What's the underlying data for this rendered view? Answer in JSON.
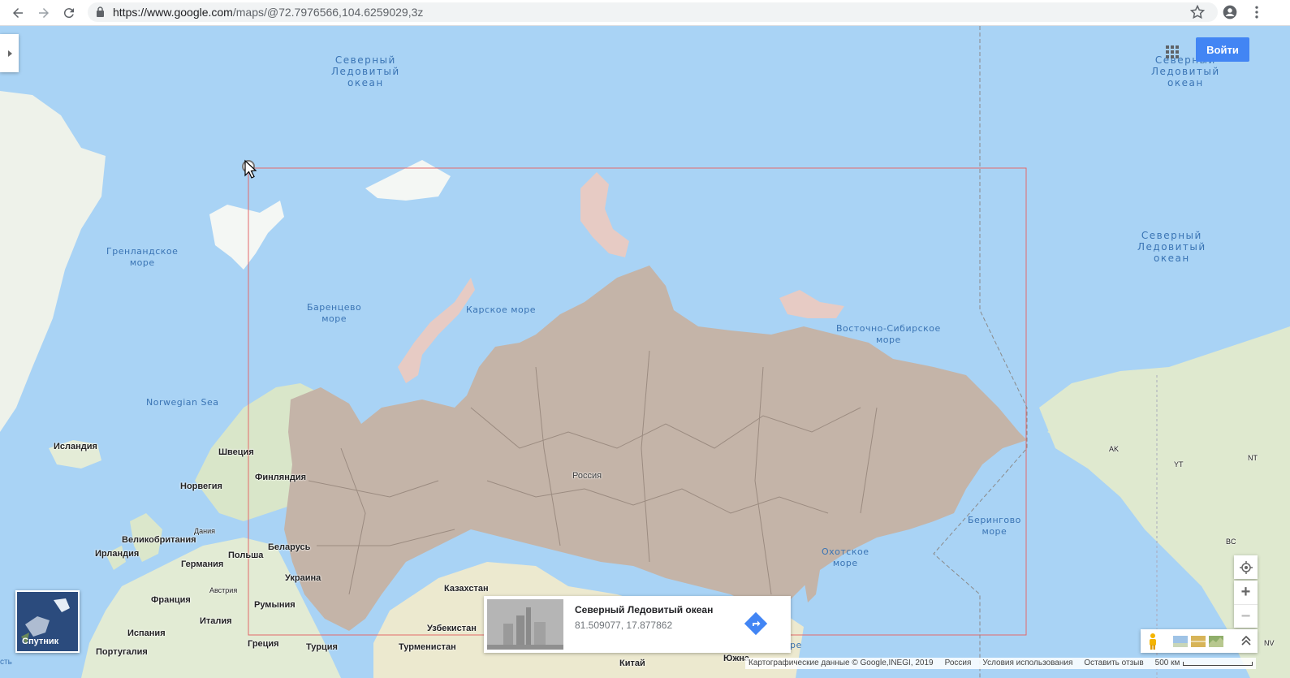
{
  "browser": {
    "url_host": "https://www.google.com",
    "url_path": "/maps/@72.7976566,104.6259029,3z"
  },
  "map": {
    "colors": {
      "water": "#a9d3f5",
      "land": "#e9eee0",
      "russia": "#c4b4a8",
      "selection_border": "#e36a6a"
    },
    "oceans": [
      "Северный\nЛедовитый\nокеан",
      "Северный\nЛедовитый\nокеан",
      "Северный\nЛедовитый\nокеан"
    ],
    "seas": {
      "greenland": "Гренландское\nморе",
      "barents": "Баренцево\nморе",
      "kara": "Карское море",
      "east_siberian": "Восточно-Сибирское\nморе",
      "norwegian": "Norwegian Sea",
      "okhotsk": "Охотское\nморе",
      "bering": "Берингово\nморе"
    },
    "countries": {
      "iceland": "Исландия",
      "sweden": "Швеция",
      "finland": "Финляндия",
      "norway": "Норвегия",
      "uk": "Великобритания",
      "denmark": "Дания",
      "ireland": "Ирландия",
      "germany": "Германия",
      "poland": "Польша",
      "belarus": "Беларусь",
      "austria": "Австрия",
      "ukraine": "Украина",
      "france": "Франция",
      "romania": "Румыния",
      "italy": "Италия",
      "spain": "Испания",
      "portugal": "Португалия",
      "greece": "Греция",
      "turkey": "Турция",
      "kazakhstan": "Казахстан",
      "uzbekistan": "Узбекистан",
      "turkmenistan": "Турменистан",
      "china": "Китай",
      "russia": "Россия",
      "south": "Южна",
      "ak": "AK",
      "yt": "YT",
      "nt": "NT",
      "bc": "BC",
      "nv": "NV",
      "sea_edge": "ре"
    }
  },
  "controls": {
    "signin_label": "Войти",
    "satellite_label": "Спутник",
    "zoom_in": "+",
    "zoom_out": "−"
  },
  "info_card": {
    "title": "Северный Ледовитый океан",
    "coords": "81.509077, 17.877862"
  },
  "footer": {
    "map_data": "Картографические данные © Google,INEGI, 2019",
    "region": "Россия",
    "terms": "Условия использования",
    "feedback": "Оставить отзыв",
    "scale": "500 км",
    "left_edge": "сть"
  }
}
